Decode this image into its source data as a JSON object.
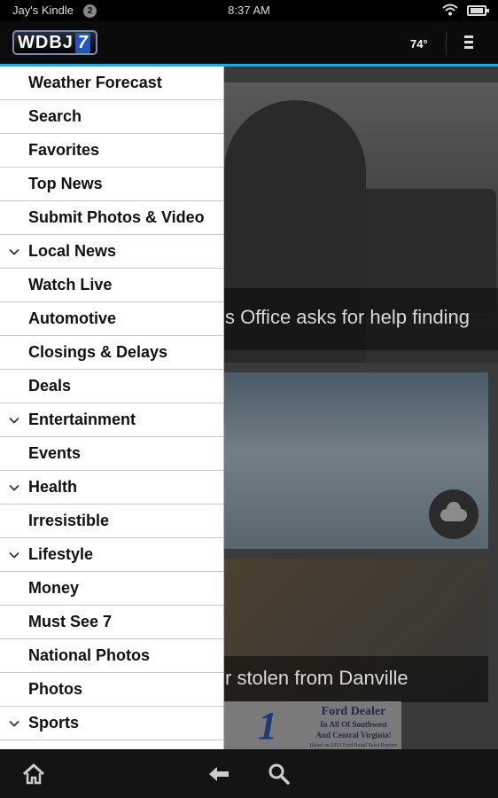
{
  "status_bar": {
    "device_name": "Jay's Kindle",
    "notification_count": "2",
    "time": "8:37 AM"
  },
  "app_bar": {
    "logo_text": "WDBJ",
    "logo_number": "7",
    "temperature": "74°"
  },
  "drawer": {
    "items": [
      {
        "label": "Weather Forecast",
        "expandable": false
      },
      {
        "label": "Search",
        "expandable": false
      },
      {
        "label": "Favorites",
        "expandable": false
      },
      {
        "label": "Top News",
        "expandable": false
      },
      {
        "label": "Submit Photos & Video",
        "expandable": false
      },
      {
        "label": "Local News",
        "expandable": true
      },
      {
        "label": "Watch Live",
        "expandable": false
      },
      {
        "label": "Automotive",
        "expandable": false
      },
      {
        "label": "Closings & Delays",
        "expandable": false
      },
      {
        "label": "Deals",
        "expandable": false
      },
      {
        "label": "Entertainment",
        "expandable": true
      },
      {
        "label": "Events",
        "expandable": false
      },
      {
        "label": "Health",
        "expandable": true
      },
      {
        "label": "Irresistible",
        "expandable": false
      },
      {
        "label": "Lifestyle",
        "expandable": true
      },
      {
        "label": "Money",
        "expandable": false
      },
      {
        "label": "Must See 7",
        "expandable": false
      },
      {
        "label": "National Photos",
        "expandable": false
      },
      {
        "label": "Photos",
        "expandable": false
      },
      {
        "label": "Sports",
        "expandable": true
      }
    ]
  },
  "content": {
    "story1_caption": "s Office asks for help finding",
    "story3_caption": "r stolen from Danville",
    "ad": {
      "number": "1",
      "title": "Ford Dealer",
      "line1": "In All Of Southwest",
      "line2": "And Central Virginia!",
      "fine_print": "Based on 2013 Ford Retail Sales Reports"
    }
  },
  "icons": {
    "wifi": "wifi-icon",
    "battery": "battery-icon",
    "menu": "overflow-menu-icon",
    "chevron": "chevron-down-icon",
    "cloud": "cloud-icon",
    "home": "home-icon",
    "back": "back-arrow-icon",
    "search": "search-icon"
  },
  "colors": {
    "accent": "#2aa6d8",
    "logo_blue": "#1f56c4",
    "drawer_bg": "#ffffff",
    "system_bar": "#141414"
  }
}
